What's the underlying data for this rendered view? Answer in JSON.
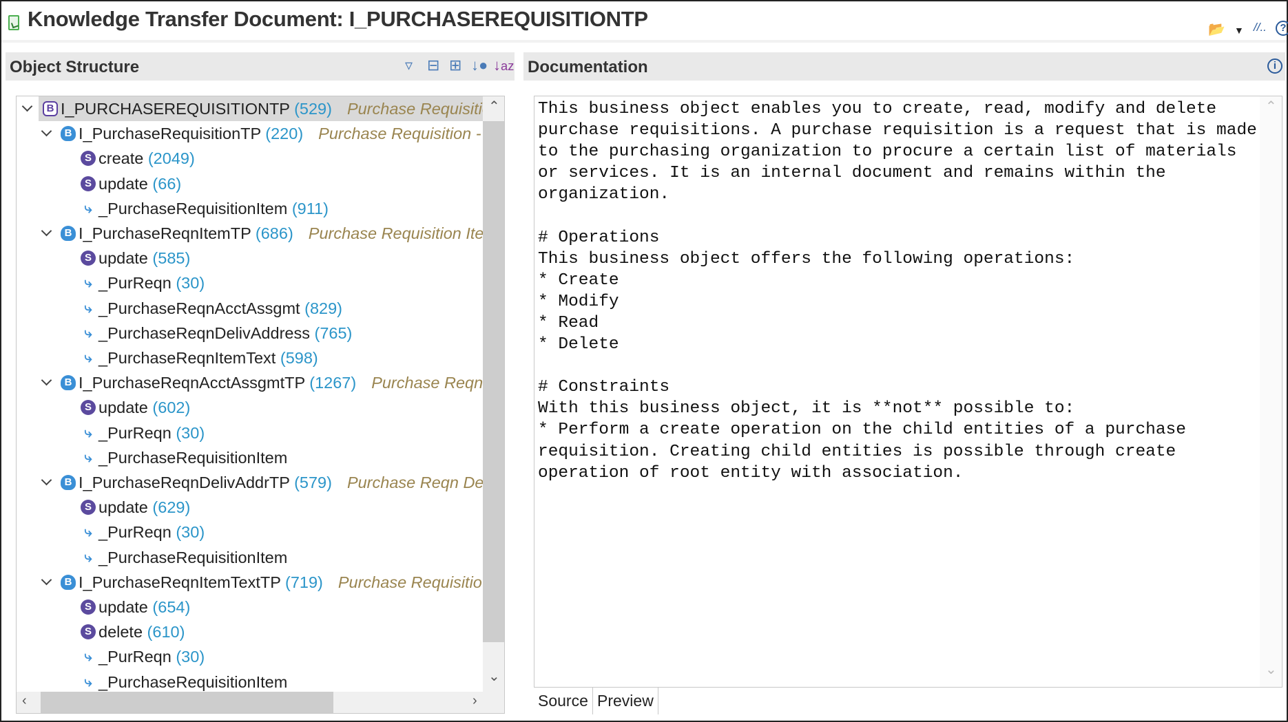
{
  "window": {
    "title": "Knowledge Transfer Document: I_PURCHASEREQUISITIONTP"
  },
  "object_structure": {
    "header": "Object Structure",
    "rows": [
      {
        "level": 0,
        "type": "bo",
        "expanded": true,
        "selected": true,
        "name": "I_PURCHASEREQUISITIONTP",
        "count": "(529)",
        "desc": "Purchase Requisition"
      },
      {
        "level": 1,
        "type": "node",
        "expanded": true,
        "name": "I_PurchaseRequisitionTP",
        "count": "(220)",
        "desc": "Purchase Requisition -"
      },
      {
        "level": 2,
        "type": "service",
        "name": "create",
        "count": "(2049)"
      },
      {
        "level": 2,
        "type": "service",
        "name": "update",
        "count": "(66)"
      },
      {
        "level": 2,
        "type": "assoc",
        "name": "_PurchaseRequisitionItem",
        "count": "(911)"
      },
      {
        "level": 1,
        "type": "node",
        "expanded": true,
        "name": "I_PurchaseReqnItemTP",
        "count": "(686)",
        "desc": "Purchase Requisition Ite"
      },
      {
        "level": 2,
        "type": "service",
        "name": "update",
        "count": "(585)"
      },
      {
        "level": 2,
        "type": "assoc",
        "name": "_PurReqn",
        "count": "(30)"
      },
      {
        "level": 2,
        "type": "assoc",
        "name": "_PurchaseReqnAcctAssgmt",
        "count": "(829)"
      },
      {
        "level": 2,
        "type": "assoc",
        "name": "_PurchaseReqnDelivAddress",
        "count": "(765)"
      },
      {
        "level": 2,
        "type": "assoc",
        "name": "_PurchaseReqnItemText",
        "count": "(598)"
      },
      {
        "level": 1,
        "type": "node",
        "expanded": true,
        "name": "I_PurchaseReqnAcctAssgmtTP",
        "count": "(1267)",
        "desc": "Purchase Reqn"
      },
      {
        "level": 2,
        "type": "service",
        "name": "update",
        "count": "(602)"
      },
      {
        "level": 2,
        "type": "assoc",
        "name": "_PurReqn",
        "count": "(30)"
      },
      {
        "level": 2,
        "type": "assoc",
        "name": "_PurchaseRequisitionItem",
        "count": ""
      },
      {
        "level": 1,
        "type": "node",
        "expanded": true,
        "name": "I_PurchaseReqnDelivAddrTP",
        "count": "(579)",
        "desc": "Purchase Reqn De"
      },
      {
        "level": 2,
        "type": "service",
        "name": "update",
        "count": "(629)"
      },
      {
        "level": 2,
        "type": "assoc",
        "name": "_PurReqn",
        "count": "(30)"
      },
      {
        "level": 2,
        "type": "assoc",
        "name": "_PurchaseRequisitionItem",
        "count": ""
      },
      {
        "level": 1,
        "type": "node",
        "expanded": true,
        "name": "I_PurchaseReqnItemTextTP",
        "count": "(719)",
        "desc": "Purchase Requisitio"
      },
      {
        "level": 2,
        "type": "service",
        "name": "update",
        "count": "(654)"
      },
      {
        "level": 2,
        "type": "service",
        "name": "delete",
        "count": "(610)"
      },
      {
        "level": 2,
        "type": "assoc",
        "name": "_PurReqn",
        "count": "(30)"
      },
      {
        "level": 2,
        "type": "assoc",
        "name": "_PurchaseRequisitionItem",
        "count": ""
      }
    ]
  },
  "documentation": {
    "header": "Documentation",
    "text": "This business object enables you to create, read, modify and delete\npurchase requisitions. A purchase requisition is a request that is made\nto the purchasing organization to procure a certain list of materials\nor services. It is an internal document and remains within the\norganization.\n\n# Operations\nThis business object offers the following operations:\n* Create\n* Modify\n* Read\n* Delete\n\n# Constraints\nWith this business object, it is **not** possible to:\n* Perform a create operation on the child entities of a purchase\nrequisition. Creating child entities is possible through create\noperation of root entity with association.",
    "tabs": [
      "Source",
      "Preview"
    ]
  }
}
